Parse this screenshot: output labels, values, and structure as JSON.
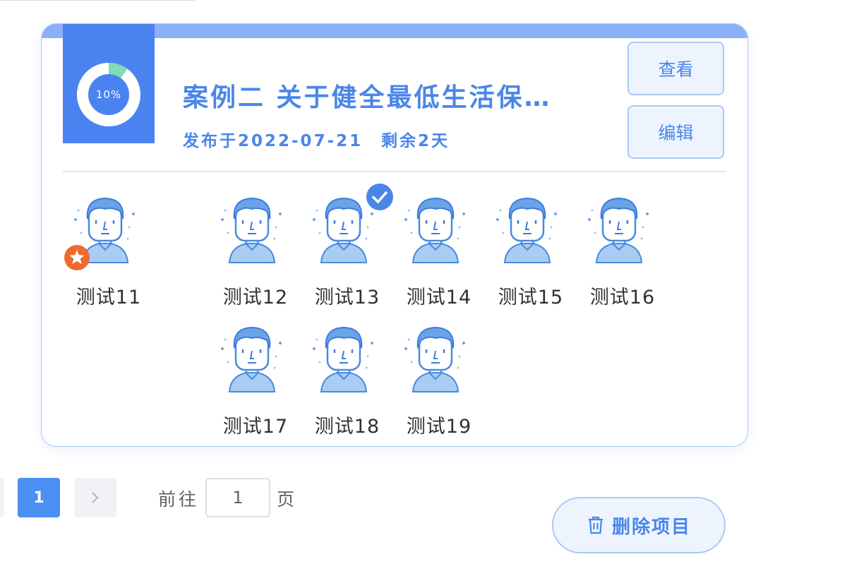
{
  "project": {
    "progress_label": "10%",
    "progress_value": 0.1,
    "title": "案例二 关于健全最低生活保…",
    "published": "发布于2022-07-21",
    "remaining": "剩余2天",
    "view_label": "查看",
    "edit_label": "编辑"
  },
  "members": [
    {
      "name": "测试11",
      "badge": "star"
    },
    {
      "name": "测试12",
      "badge": ""
    },
    {
      "name": "测试13",
      "badge": "check"
    },
    {
      "name": "测试14",
      "badge": ""
    },
    {
      "name": "测试15",
      "badge": ""
    },
    {
      "name": "测试16",
      "badge": ""
    },
    {
      "name": "测试17",
      "badge": ""
    },
    {
      "name": "测试18",
      "badge": ""
    },
    {
      "name": "测试19",
      "badge": ""
    }
  ],
  "pagination": {
    "current_page": "1",
    "goto_label": "前往",
    "goto_value": "1",
    "page_suffix": "页"
  },
  "actions": {
    "delete_label": "删除项目"
  },
  "colors": {
    "accent": "#4a86e8",
    "progress_block": "#4a83f0",
    "progress_fill": "#7fdcb4",
    "star_badge": "#ee6a2f"
  }
}
